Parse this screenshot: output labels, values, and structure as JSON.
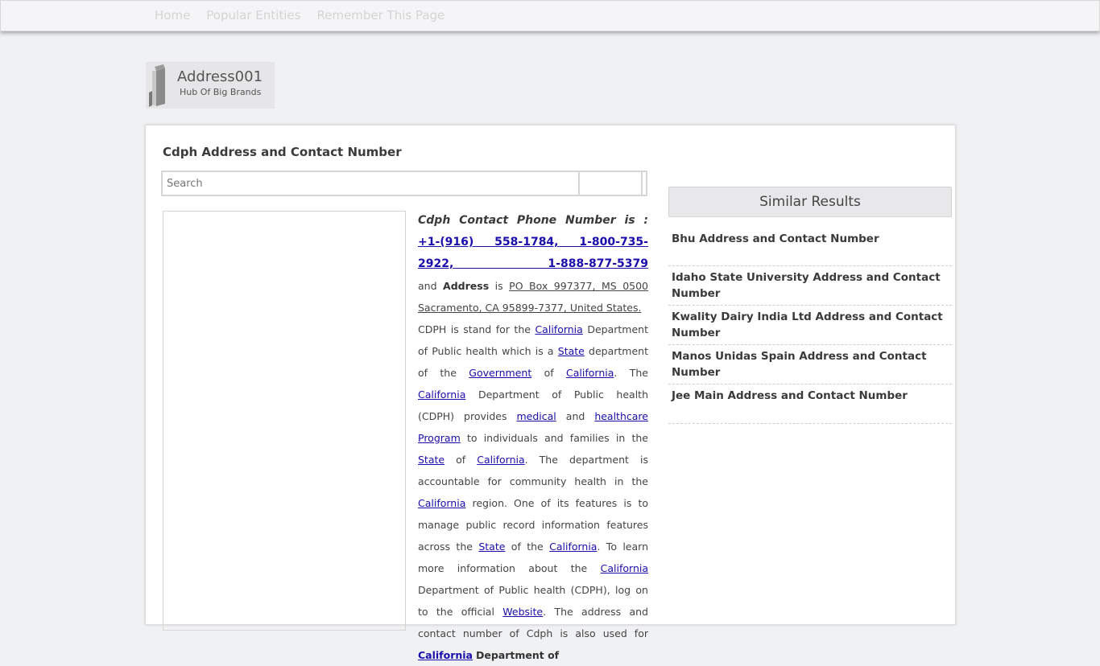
{
  "nav": {
    "items": [
      "Home",
      "Popular Entities",
      "Remember This Page"
    ]
  },
  "logo": {
    "title": "Address001",
    "subtitle": "Hub Of Big Brands"
  },
  "page": {
    "title": "Cdph Address and Contact Number"
  },
  "search": {
    "placeholder": "Search",
    "value": ""
  },
  "article": {
    "phone_label": "Cdph Contact Phone Number is :",
    "phone_numbers": "+1-(916) 558-1784, 1-800-735-2922, 1-888-877-5379",
    "and": "and",
    "address_label": "Address",
    "is": "is",
    "address_value": "PO Box 997377, MS 0500 Sacramento, CA 95899-7377, United States.",
    "link_california": "California",
    "link_state": "State",
    "link_government": "Government",
    "link_medical": "medical",
    "link_healthcare": "healthcare",
    "link_program": "Program",
    "link_website": "Website",
    "t1": "CDPH is stand for the",
    "t2": "Department of Public health which is a",
    "t3": "department of the",
    "t4": "of",
    "t5": ". The",
    "t6": "Department of Public health (CDPH) provides",
    "t7": "and",
    "t8": "to individuals and families in the",
    "t9": "of",
    "t10": ". The department is accountable for community health in the",
    "t11": "region. One of its features is to manage public record information features across the",
    "t12": "of the",
    "t13": ". To learn more information about the",
    "t14": "Department of Public health (CDPH), log on to the official",
    "t15": ". The address and contact number of Cdph is also used for",
    "t16": "Department of"
  },
  "similar": {
    "heading": "Similar Results",
    "items": [
      "Bhu Address and Contact Number",
      "Idaho State University Address and Contact Number",
      "Kwality Dairy India Ltd Address and Contact Number",
      "Manos Unidas Spain Address and Contact Number",
      "Jee Main Address and Contact Number"
    ]
  },
  "colors": {
    "link": "#1a0dab",
    "background": "#f0f1f3",
    "card": "#ffffff"
  }
}
